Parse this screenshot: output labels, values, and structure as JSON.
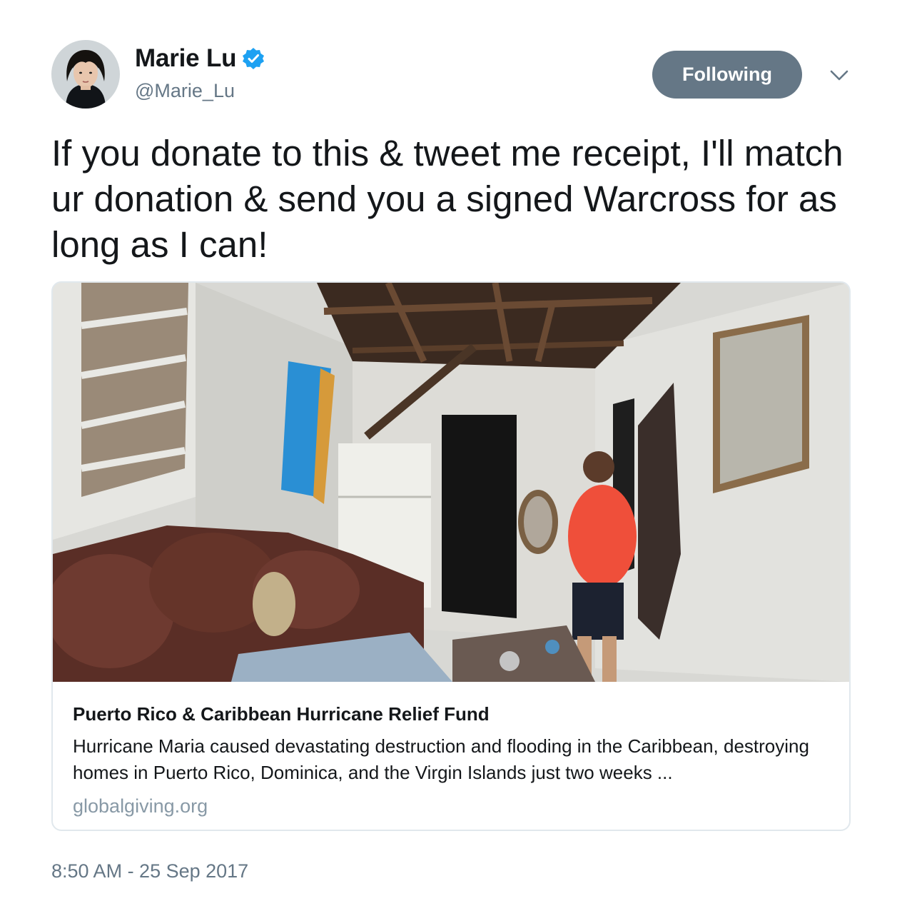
{
  "author": {
    "display_name": "Marie Lu",
    "handle": "@Marie_Lu",
    "verified": true,
    "avatar_icon": "profile-photo"
  },
  "actions": {
    "follow_label": "Following",
    "menu_icon": "chevron-down-icon"
  },
  "tweet": {
    "text": "If you donate to this & tweet me receipt, I'll match ur donation & send you a signed Warcross for as long as I can!",
    "timestamp": "8:50 AM - 25 Sep 2017"
  },
  "card": {
    "title": "Puerto Rico & Caribbean Hurricane Relief Fund",
    "description": "Hurricane Maria caused devastating destruction and flooding in the Caribbean, destroying homes in Puerto Rico, Dominica, and the Virgin Islands just two weeks ...",
    "domain": "globalgiving.org"
  },
  "colors": {
    "text_primary": "#14171a",
    "text_secondary": "#657786",
    "verified_blue": "#1da1f2",
    "following_button": "#657786",
    "card_border": "#e1e8ed"
  }
}
